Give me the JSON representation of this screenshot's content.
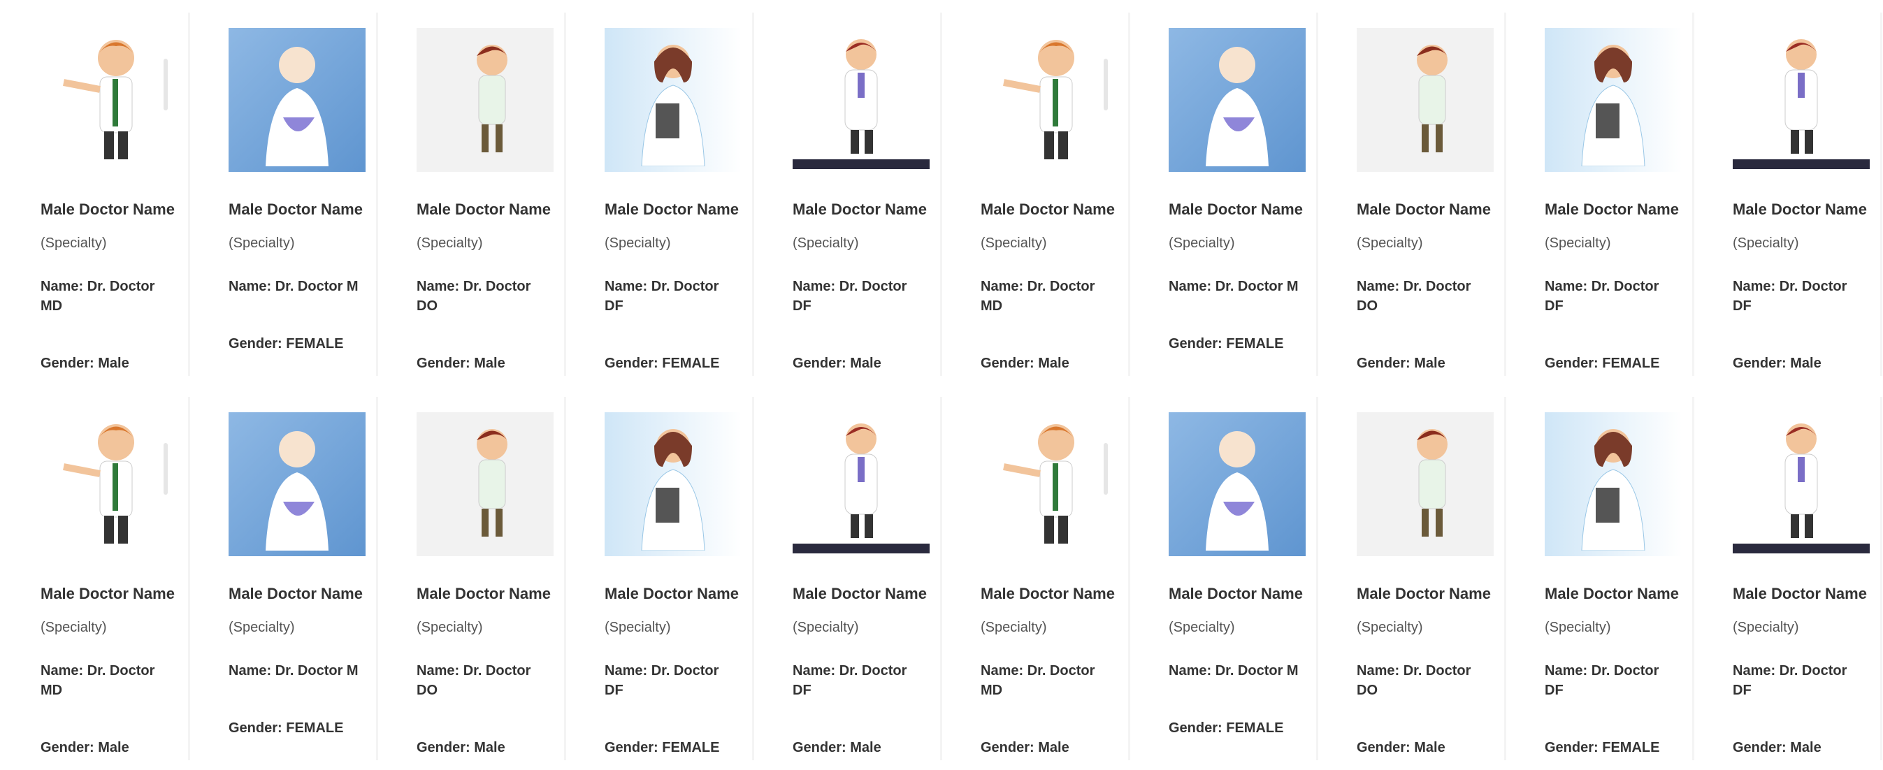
{
  "cards": [
    {
      "name": "Male Doctor Name",
      "specialty": "(Specialty)",
      "reg": "Name: Dr. Doctor MD",
      "gender": "Gender: Male",
      "bg": "white"
    },
    {
      "name": "Male Doctor Name",
      "specialty": "(Specialty)",
      "reg": "Name: Dr. Doctor M",
      "gender": "Gender: FEMALE",
      "bg": "blue"
    },
    {
      "name": "Male Doctor Name",
      "specialty": "(Specialty)",
      "reg": "Name: Dr. Doctor DO",
      "gender": "Gender: Male",
      "bg": "light"
    },
    {
      "name": "Male Doctor Name",
      "specialty": "(Specialty)",
      "reg": "Name: Dr. Doctor DF",
      "gender": "Gender: FEMALE",
      "bg": "bluewhite"
    },
    {
      "name": "Male Doctor Name",
      "specialty": "(Specialty)",
      "reg": "Name: Dr. Doctor DF",
      "gender": "Gender: Male",
      "bg": "floor"
    },
    {
      "name": "Male Doctor Name",
      "specialty": "(Specialty)",
      "reg": "Name: Dr. Doctor MD",
      "gender": "Gender: Male",
      "bg": "white"
    },
    {
      "name": "Male Doctor Name",
      "specialty": "(Specialty)",
      "reg": "Name: Dr. Doctor M",
      "gender": "Gender: FEMALE",
      "bg": "blue"
    },
    {
      "name": "Male Doctor Name",
      "specialty": "(Specialty)",
      "reg": "Name: Dr. Doctor DO",
      "gender": "Gender: Male",
      "bg": "light"
    },
    {
      "name": "Male Doctor Name",
      "specialty": "(Specialty)",
      "reg": "Name: Dr. Doctor DF",
      "gender": "Gender: FEMALE",
      "bg": "bluewhite"
    },
    {
      "name": "Male Doctor Name",
      "specialty": "(Specialty)",
      "reg": "Name: Dr. Doctor DF",
      "gender": "Gender: Male",
      "bg": "floor"
    },
    {
      "name": "Male Doctor Name",
      "specialty": "(Specialty)",
      "reg": "Name: Dr. Doctor MD",
      "gender": "Gender: Male",
      "bg": "white"
    },
    {
      "name": "Male Doctor Name",
      "specialty": "(Specialty)",
      "reg": "Name: Dr. Doctor M",
      "gender": "Gender: FEMALE",
      "bg": "blue"
    },
    {
      "name": "Male Doctor Name",
      "specialty": "(Specialty)",
      "reg": "Name: Dr. Doctor DO",
      "gender": "Gender: Male",
      "bg": "light"
    },
    {
      "name": "Male Doctor Name",
      "specialty": "(Specialty)",
      "reg": "Name: Dr. Doctor DF",
      "gender": "Gender: FEMALE",
      "bg": "bluewhite"
    },
    {
      "name": "Male Doctor Name",
      "specialty": "(Specialty)",
      "reg": "Name: Dr. Doctor DF",
      "gender": "Gender: Male",
      "bg": "floor"
    },
    {
      "name": "Male Doctor Name",
      "specialty": "(Specialty)",
      "reg": "Name: Dr. Doctor MD",
      "gender": "Gender: Male",
      "bg": "white"
    },
    {
      "name": "Male Doctor Name",
      "specialty": "(Specialty)",
      "reg": "Name: Dr. Doctor M",
      "gender": "Gender: FEMALE",
      "bg": "blue"
    },
    {
      "name": "Male Doctor Name",
      "specialty": "(Specialty)",
      "reg": "Name: Dr. Doctor DO",
      "gender": "Gender: Male",
      "bg": "light"
    },
    {
      "name": "Male Doctor Name",
      "specialty": "(Specialty)",
      "reg": "Name: Dr. Doctor DF",
      "gender": "Gender: FEMALE",
      "bg": "bluewhite"
    },
    {
      "name": "Male Doctor Name",
      "specialty": "(Specialty)",
      "reg": "Name: Dr. Doctor DF",
      "gender": "Gender: Male",
      "bg": "floor"
    }
  ]
}
